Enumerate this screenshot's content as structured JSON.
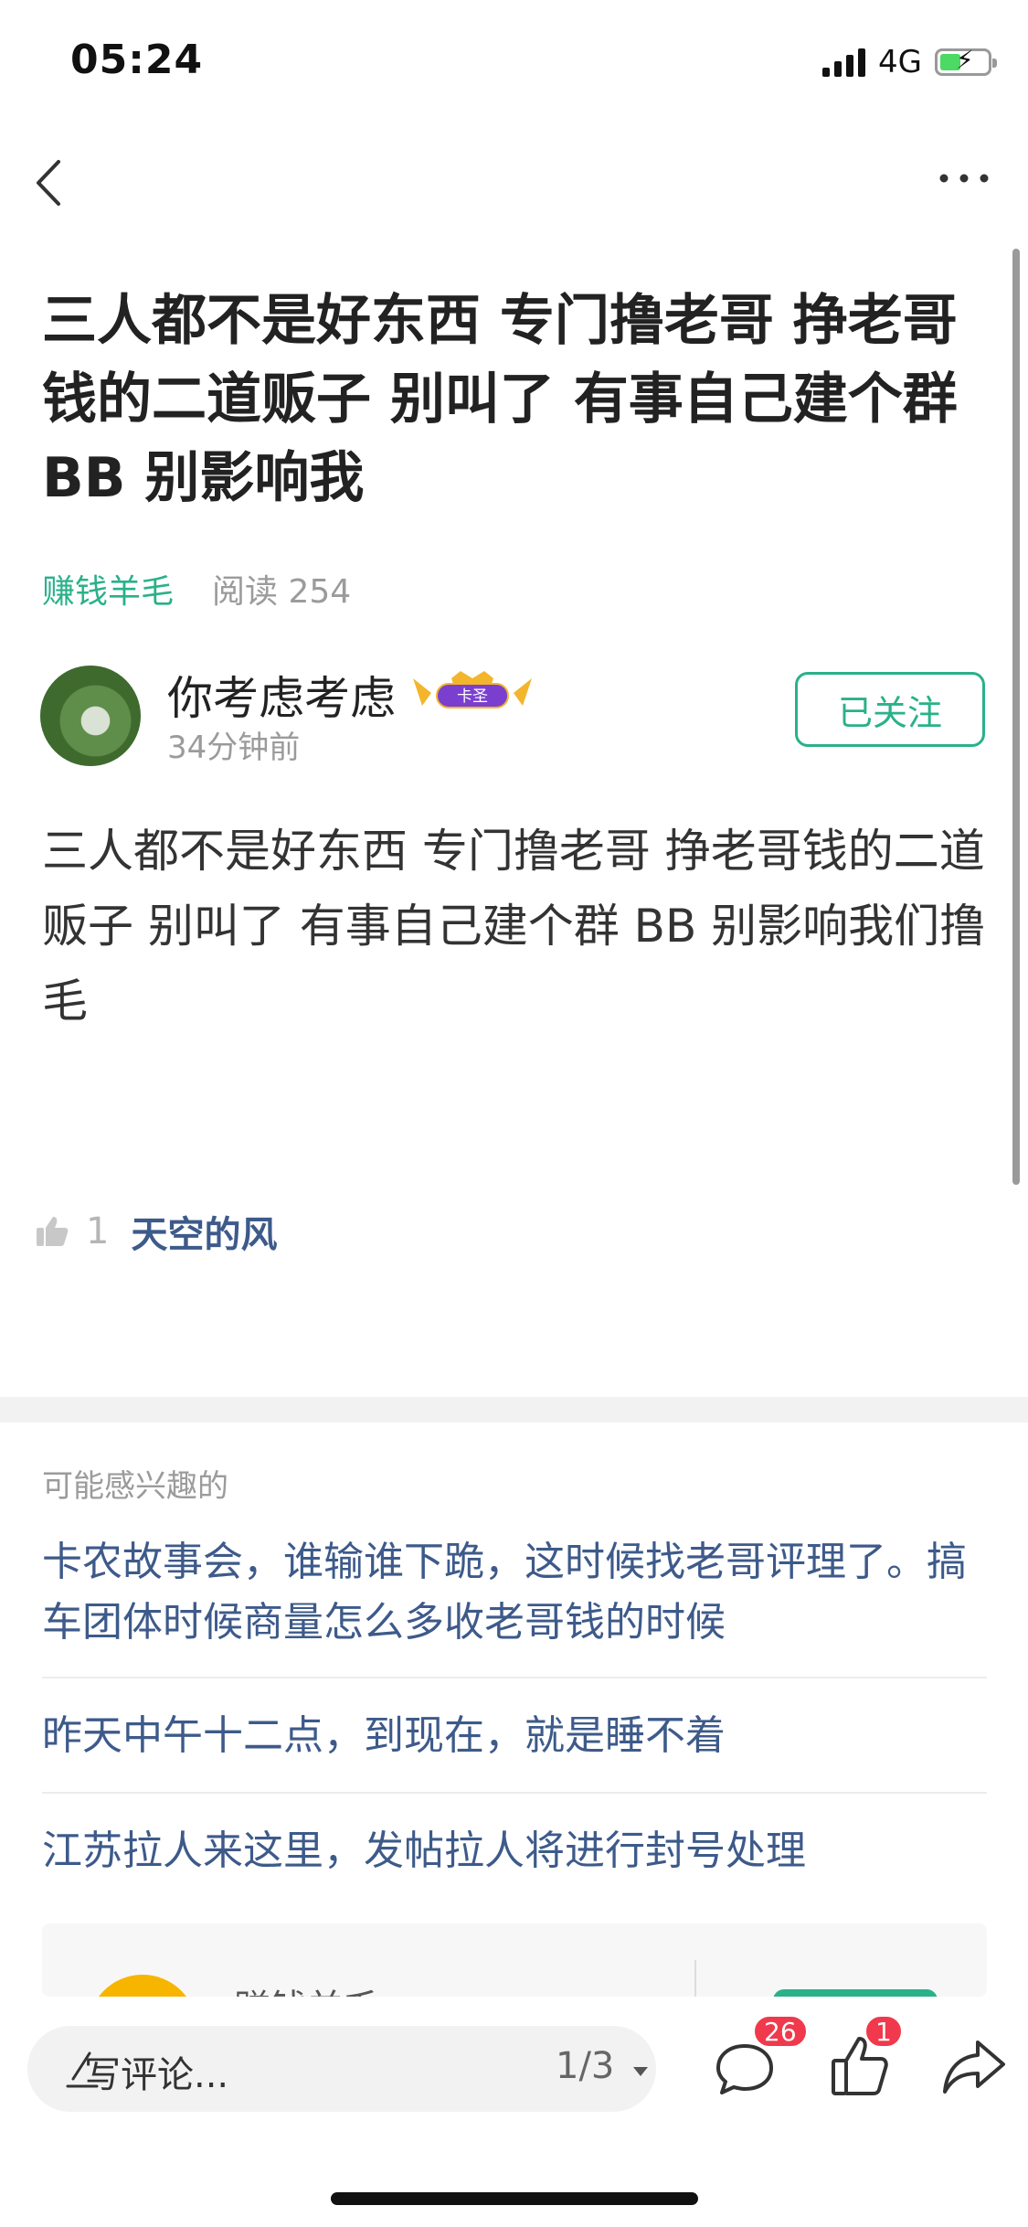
{
  "status_bar": {
    "time": "05:24",
    "network": "4G",
    "signal_bars": 4,
    "battery_level": 0.4
  },
  "nav": {
    "back_icon": "chevron-left-icon",
    "more_icon": "more-horizontal-icon"
  },
  "post": {
    "title": "三人都不是好东西 专门撸老哥 挣老哥钱的二道贩子 别叫了 有事自己建个群BB 别影响我",
    "category": "赚钱羊毛",
    "read_label": "阅读",
    "read_count": "254",
    "author": {
      "name": "你考虑考虑",
      "badge": "卡圣",
      "time": "34分钟前",
      "follow_label": "已关注"
    },
    "body": "三人都不是好东西 专门撸老哥 挣老哥钱的二道贩子 别叫了 有事自己建个群 BB 别影响我们撸毛",
    "likes": {
      "count": "1",
      "liker": "天空的风"
    }
  },
  "related": {
    "heading": "可能感兴趣的",
    "items": [
      {
        "title": "卡农故事会，谁输谁下跪，这时候找老哥评理了。搞车团体时候商量怎么多收老哥钱的时候"
      },
      {
        "title": "昨天中午十二点，到现在，就是睡不着"
      },
      {
        "title": "江苏拉人来这里，发帖拉人将进行封号处理"
      }
    ],
    "card": {
      "title": "赚钱羊毛"
    }
  },
  "bottom_bar": {
    "comment_placeholder": "写评论...",
    "page_indicator": "1/3",
    "comment_count": "26",
    "like_count": "1",
    "icons": [
      "pencil-icon",
      "comment-icon",
      "thumbs-up-icon",
      "share-icon"
    ]
  },
  "colors": {
    "accent": "#2ab189",
    "link": "#3d5a8a",
    "badge": "#f0394c"
  }
}
